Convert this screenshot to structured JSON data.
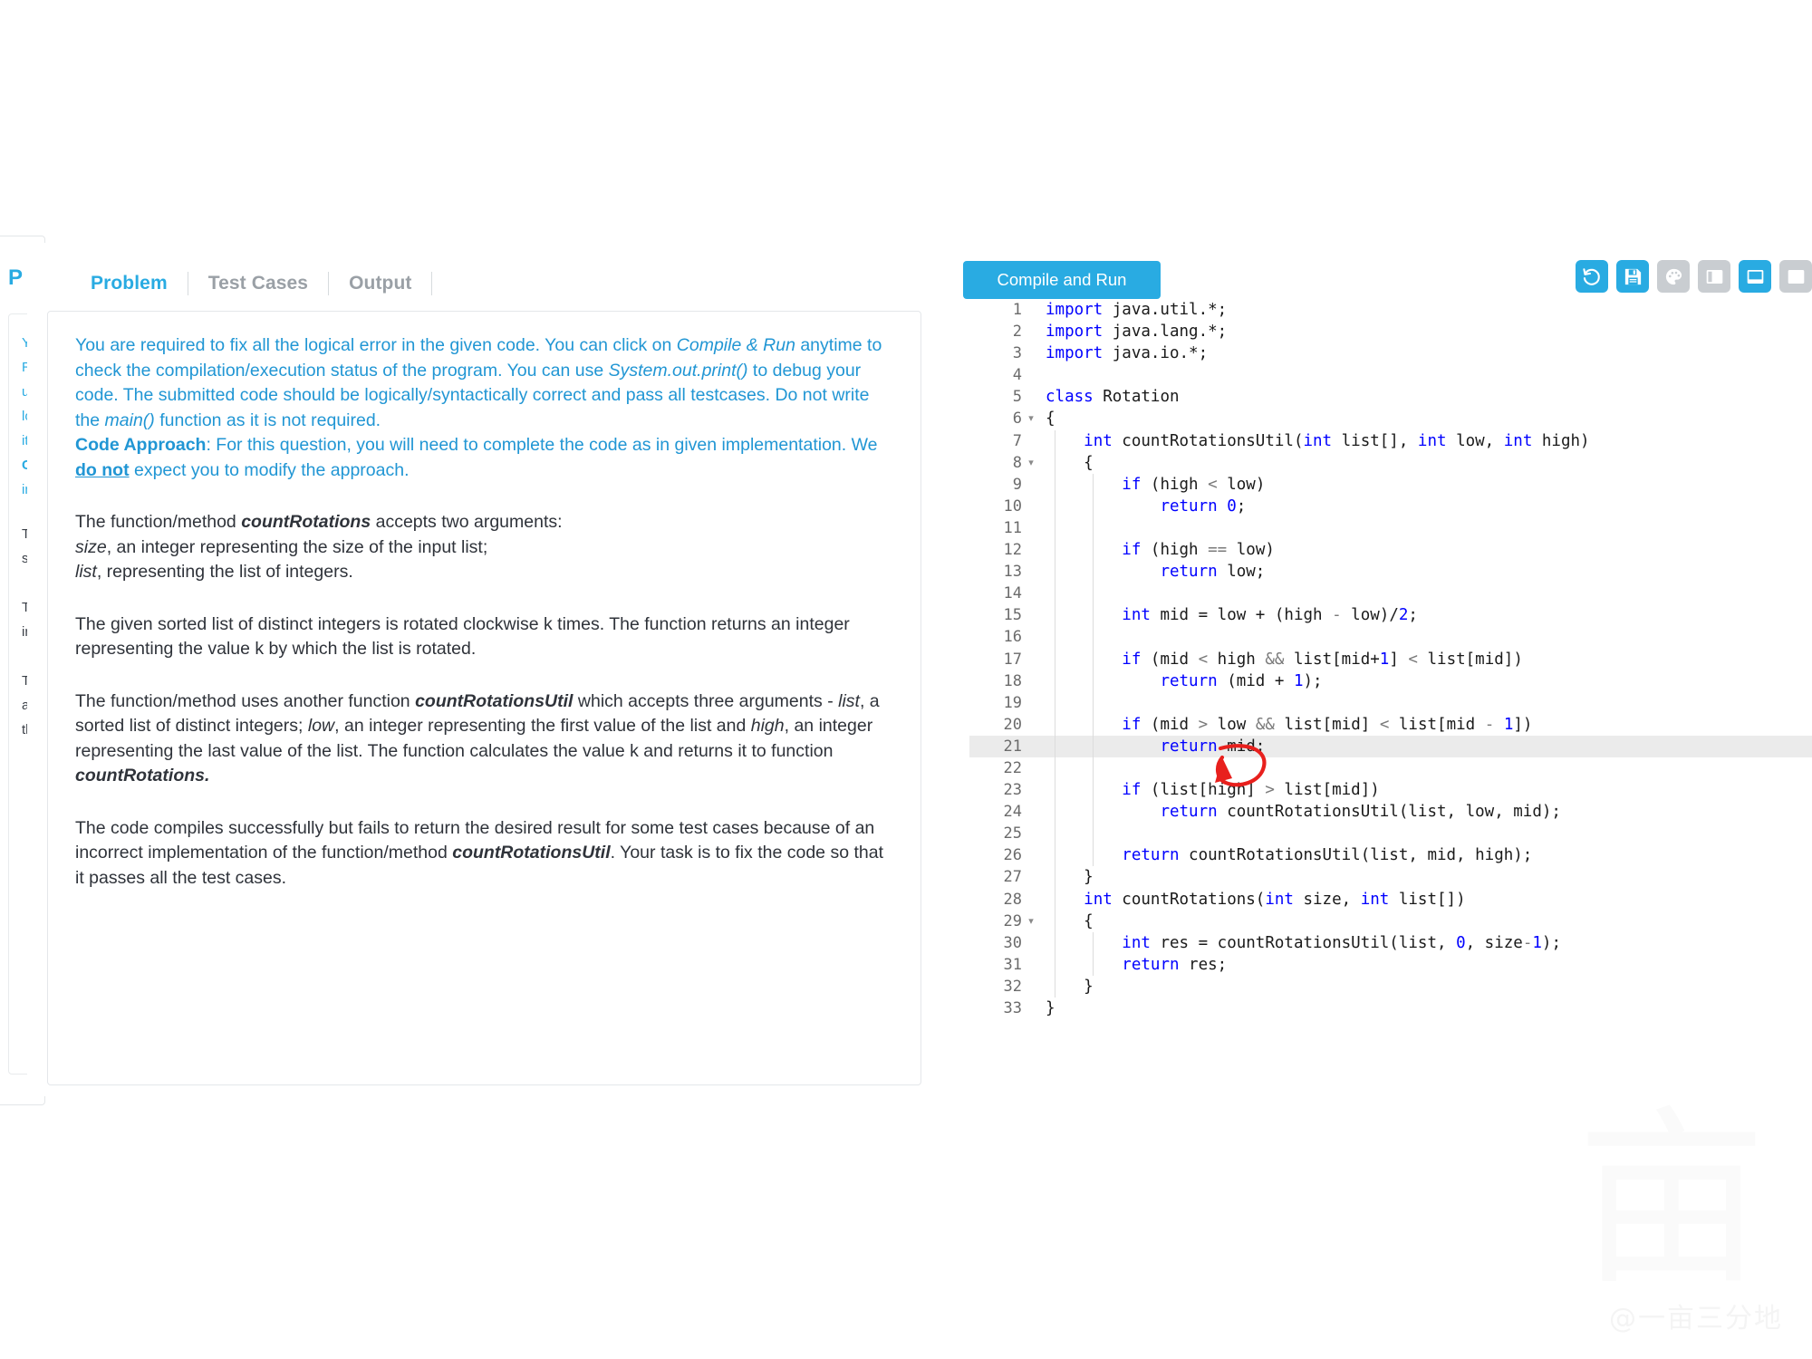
{
  "background_panel": {
    "title": "P",
    "lines": [
      "You are required to fix all the logical error",
      "Run anytime to check the compilation/exe",
      "use System.out.print() to debug your code",
      "logically/syntactically correct and pass all",
      "it is not required.",
      "Code Approach: For this question, you will",
      "implementation. We do not expect you to"
    ],
    "dark_lines": [
      "The function/method countRotations accep",
      "size, an integer representing the size of th",
      "",
      "The given sorted list of distinct integers is",
      "integer representing the value k by which",
      "",
      "The function/method uses another function",
      "arguments - list, a sorted list of distinct int",
      "the list and high, an integer representing t"
    ]
  },
  "tabs": [
    {
      "label": "Problem",
      "active": true
    },
    {
      "label": "Test Cases",
      "active": false
    },
    {
      "label": "Output",
      "active": false
    }
  ],
  "problem": {
    "intro_html": "You are required to fix all the logical error in the given code. You can click on <i>Compile &amp; Run</i> anytime to check the compilation/execution status of the program. You can use <i>System.out.print()</i> to debug your code. The submitted code should be logically/syntactically correct and pass all testcases. Do not write the <i>main()</i> function as it is not required.<br><b>Code Approach</b>: For this question, you will need to complete the code as in given implementation. We <u class=\"bu\">do not</u> expect you to modify the approach.",
    "para1_html": "The function/method <b>countRotations</b> accepts two arguments:<br><i>size</i>, an integer representing the size of the input list;<br><i>list</i>, representing the list of integers.",
    "para2_html": "The given sorted list of distinct integers is rotated clockwise k times. The function returns an integer representing the value k by which the list is rotated.",
    "para3_html": "The function/method uses another function <b>countRotationsUtil</b> which accepts three arguments - <i>list</i>, a sorted list of distinct integers; <i>low</i>, an integer representing the first value of the list and <i>high</i>, an integer representing the last value of the list. The function calculates the value k and returns it to function <b>countRotations.</b>",
    "para4_html": "The code compiles successfully but fails to return the desired result for some test cases because of an incorrect implementation of the function/method <b>countRotationsUtil</b>. Your task is to fix the code so that it passes all the test cases."
  },
  "toolbar": {
    "run_label": "Compile and Run",
    "icons": [
      {
        "name": "reset-icon",
        "state": "blue"
      },
      {
        "name": "save-icon",
        "state": "blue"
      },
      {
        "name": "theme-palette-icon",
        "state": "gray"
      },
      {
        "name": "split-vertical-layout-icon",
        "state": "gray"
      },
      {
        "name": "split-horizontal-layout-icon",
        "state": "blue"
      },
      {
        "name": "fullscreen-layout-icon",
        "state": "gray"
      }
    ]
  },
  "editor": {
    "language": "java",
    "highlighted_line": 21,
    "fold_lines": [
      6,
      8,
      29
    ],
    "lines": [
      {
        "n": 1,
        "tokens": [
          [
            "kw",
            "import"
          ],
          [
            "txt",
            " java.util.*;"
          ]
        ],
        "indent": 0
      },
      {
        "n": 2,
        "tokens": [
          [
            "kw",
            "import"
          ],
          [
            "txt",
            " java.lang.*;"
          ]
        ],
        "indent": 0
      },
      {
        "n": 3,
        "tokens": [
          [
            "kw",
            "import"
          ],
          [
            "txt",
            " java.io.*;"
          ]
        ],
        "indent": 0
      },
      {
        "n": 4,
        "tokens": [],
        "indent": 0
      },
      {
        "n": 5,
        "tokens": [
          [
            "kw",
            "class"
          ],
          [
            "txt",
            " Rotation"
          ]
        ],
        "indent": 0
      },
      {
        "n": 6,
        "tokens": [
          [
            "txt",
            "{"
          ]
        ],
        "indent": 0
      },
      {
        "n": 7,
        "tokens": [
          [
            "txt",
            "    "
          ],
          [
            "kw",
            "int"
          ],
          [
            "txt",
            " countRotationsUtil("
          ],
          [
            "kw",
            "int"
          ],
          [
            "txt",
            " list[], "
          ],
          [
            "kw",
            "int"
          ],
          [
            "txt",
            " low, "
          ],
          [
            "kw",
            "int"
          ],
          [
            "txt",
            " high)"
          ]
        ],
        "indent": 1
      },
      {
        "n": 8,
        "tokens": [
          [
            "txt",
            "    {"
          ]
        ],
        "indent": 1
      },
      {
        "n": 9,
        "tokens": [
          [
            "txt",
            "        "
          ],
          [
            "kw",
            "if"
          ],
          [
            "txt",
            " (high "
          ],
          [
            "op",
            "<"
          ],
          [
            "txt",
            " low)"
          ]
        ],
        "indent": 2
      },
      {
        "n": 10,
        "tokens": [
          [
            "txt",
            "            "
          ],
          [
            "kw",
            "return"
          ],
          [
            "txt",
            " "
          ],
          [
            "num",
            "0"
          ],
          [
            "txt",
            ";"
          ]
        ],
        "indent": 2
      },
      {
        "n": 11,
        "tokens": [],
        "indent": 2
      },
      {
        "n": 12,
        "tokens": [
          [
            "txt",
            "        "
          ],
          [
            "kw",
            "if"
          ],
          [
            "txt",
            " (high "
          ],
          [
            "op",
            "=="
          ],
          [
            "txt",
            " low)"
          ]
        ],
        "indent": 2
      },
      {
        "n": 13,
        "tokens": [
          [
            "txt",
            "            "
          ],
          [
            "kw",
            "return"
          ],
          [
            "txt",
            " low;"
          ]
        ],
        "indent": 2
      },
      {
        "n": 14,
        "tokens": [],
        "indent": 2
      },
      {
        "n": 15,
        "tokens": [
          [
            "txt",
            "        "
          ],
          [
            "kw",
            "int"
          ],
          [
            "txt",
            " mid = low + (high "
          ],
          [
            "op",
            "-"
          ],
          [
            "txt",
            " low)/"
          ],
          [
            "num",
            "2"
          ],
          [
            "txt",
            ";"
          ]
        ],
        "indent": 2
      },
      {
        "n": 16,
        "tokens": [],
        "indent": 2
      },
      {
        "n": 17,
        "tokens": [
          [
            "txt",
            "        "
          ],
          [
            "kw",
            "if"
          ],
          [
            "txt",
            " (mid "
          ],
          [
            "op",
            "<"
          ],
          [
            "txt",
            " high "
          ],
          [
            "op",
            "&&"
          ],
          [
            "txt",
            " list[mid+"
          ],
          [
            "num",
            "1"
          ],
          [
            "txt",
            "] "
          ],
          [
            "op",
            "<"
          ],
          [
            "txt",
            " list[mid])"
          ]
        ],
        "indent": 2
      },
      {
        "n": 18,
        "tokens": [
          [
            "txt",
            "            "
          ],
          [
            "kw",
            "return"
          ],
          [
            "txt",
            " (mid + "
          ],
          [
            "num",
            "1"
          ],
          [
            "txt",
            ");"
          ]
        ],
        "indent": 2
      },
      {
        "n": 19,
        "tokens": [],
        "indent": 2
      },
      {
        "n": 20,
        "tokens": [
          [
            "txt",
            "        "
          ],
          [
            "kw",
            "if"
          ],
          [
            "txt",
            " (mid "
          ],
          [
            "op",
            ">"
          ],
          [
            "txt",
            " low "
          ],
          [
            "op",
            "&&"
          ],
          [
            "txt",
            " list[mid] "
          ],
          [
            "op",
            "<"
          ],
          [
            "txt",
            " list[mid "
          ],
          [
            "op",
            "-"
          ],
          [
            "txt",
            " "
          ],
          [
            "num",
            "1"
          ],
          [
            "txt",
            "])"
          ]
        ],
        "indent": 2
      },
      {
        "n": 21,
        "tokens": [
          [
            "txt",
            "            "
          ],
          [
            "kw",
            "return"
          ],
          [
            "txt",
            " mid;"
          ]
        ],
        "indent": 2
      },
      {
        "n": 22,
        "tokens": [],
        "indent": 2
      },
      {
        "n": 23,
        "tokens": [
          [
            "txt",
            "        "
          ],
          [
            "kw",
            "if"
          ],
          [
            "txt",
            " (list[high] "
          ],
          [
            "op",
            ">"
          ],
          [
            "txt",
            " list[mid])"
          ]
        ],
        "indent": 2
      },
      {
        "n": 24,
        "tokens": [
          [
            "txt",
            "            "
          ],
          [
            "kw",
            "return"
          ],
          [
            "txt",
            " countRotationsUtil(list, low, mid);"
          ]
        ],
        "indent": 2
      },
      {
        "n": 25,
        "tokens": [],
        "indent": 2
      },
      {
        "n": 26,
        "tokens": [
          [
            "txt",
            "        "
          ],
          [
            "kw",
            "return"
          ],
          [
            "txt",
            " countRotationsUtil(list, mid, high);"
          ]
        ],
        "indent": 2
      },
      {
        "n": 27,
        "tokens": [
          [
            "txt",
            "    }"
          ]
        ],
        "indent": 1
      },
      {
        "n": 28,
        "tokens": [
          [
            "txt",
            "    "
          ],
          [
            "kw",
            "int"
          ],
          [
            "txt",
            " countRotations("
          ],
          [
            "kw",
            "int"
          ],
          [
            "txt",
            " size, "
          ],
          [
            "kw",
            "int"
          ],
          [
            "txt",
            " list[])"
          ]
        ],
        "indent": 1
      },
      {
        "n": 29,
        "tokens": [
          [
            "txt",
            "    {"
          ]
        ],
        "indent": 1
      },
      {
        "n": 30,
        "tokens": [
          [
            "txt",
            "        "
          ],
          [
            "kw",
            "int"
          ],
          [
            "txt",
            " res = countRotationsUtil(list, "
          ],
          [
            "num",
            "0"
          ],
          [
            "txt",
            ", size"
          ],
          [
            "op",
            "-"
          ],
          [
            "num",
            "1"
          ],
          [
            "txt",
            ");"
          ]
        ],
        "indent": 2
      },
      {
        "n": 31,
        "tokens": [
          [
            "txt",
            "        "
          ],
          [
            "kw",
            "return"
          ],
          [
            "txt",
            " res;"
          ]
        ],
        "indent": 2
      },
      {
        "n": 32,
        "tokens": [
          [
            "txt",
            "    }"
          ]
        ],
        "indent": 1
      },
      {
        "n": 33,
        "tokens": [
          [
            "txt",
            "}"
          ]
        ],
        "indent": 0
      }
    ]
  },
  "annotation": {
    "shape": "hand-drawn-red-circle",
    "target_text": "mid",
    "target_line": 21,
    "color": "#e8201d"
  },
  "watermark": {
    "handle": "@一亩三分地",
    "glyph": "亩"
  },
  "colors": {
    "accent": "#29abe2",
    "problem_text_blue": "#2196d4",
    "body_text": "#2f333a",
    "tab_inactive": "#9aa0a6",
    "editor_keyword": "#0000ff",
    "editor_highlight_row": "#ebebeb",
    "gutter_bg": "#f7f7f7"
  }
}
